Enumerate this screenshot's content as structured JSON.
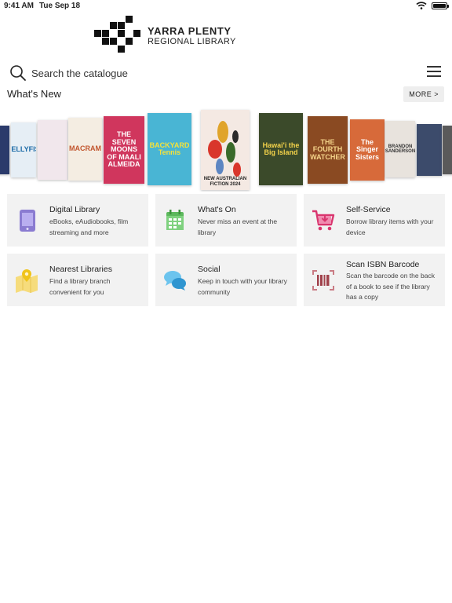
{
  "status_bar": {
    "time": "9:41 AM",
    "date": "Tue Sep 18",
    "battery_level": 1.0
  },
  "logo": {
    "title": "YARRA PLENTY",
    "subtitle": "REGIONAL LIBRARY"
  },
  "search": {
    "placeholder": "Search the catalogue"
  },
  "whats_new": {
    "title": "What's New",
    "more_label": "MORE >"
  },
  "books": [
    {
      "text": "",
      "color": "#2b3a6b"
    },
    {
      "text": "JELLYFIS",
      "color": "#e6eef5"
    },
    {
      "text": "",
      "color": "#f1e7ec"
    },
    {
      "text": "MACRAM",
      "color": "#f4ede2"
    },
    {
      "text": "THE SEVEN MOONS OF MAALI ALMEIDA",
      "color": "#d0365d"
    },
    {
      "text": "BACKYARD Tennis",
      "color": "#49b5d4"
    },
    {
      "text": "NEW AUSTRALIAN FICTION 2024",
      "color": "#f4e9e3"
    },
    {
      "text": "Hawai'i the Big Island",
      "color": "#3b4a2a"
    },
    {
      "text": "THE FOURTH WATCHER",
      "color": "#8a4a22"
    },
    {
      "text": "The Singer Sisters",
      "color": "#d76a3a"
    },
    {
      "text": "BRANDON SANDERSON",
      "color": "#e8e3dd"
    },
    {
      "text": "",
      "color": "#3c4b6b"
    },
    {
      "text": "",
      "color": "#5a5a5a"
    }
  ],
  "tiles": [
    {
      "title": "Digital Library",
      "description": "eBooks, eAudiobooks, film streaming and more",
      "icon": "tablet-icon",
      "color": "#8a7bd1"
    },
    {
      "title": "What's On",
      "description": "Never miss an event at the library",
      "icon": "calendar-icon",
      "color": "#5cb85c"
    },
    {
      "title": "Self-Service",
      "description": "Borrow library items with your device",
      "icon": "cart-icon",
      "color": "#d9356e"
    },
    {
      "title": "Nearest Libraries",
      "description": "Find a library branch convenient for you",
      "icon": "map-icon",
      "color": "#f0c419"
    },
    {
      "title": "Social",
      "description": "Keep in touch with your library community",
      "icon": "chat-icon",
      "color": "#3fa9e0"
    },
    {
      "title": "Scan ISBN Barcode",
      "description": "Scan the barcode on the back of a book to see if the library has a copy",
      "icon": "barcode-icon",
      "color": "#a0414b"
    }
  ]
}
